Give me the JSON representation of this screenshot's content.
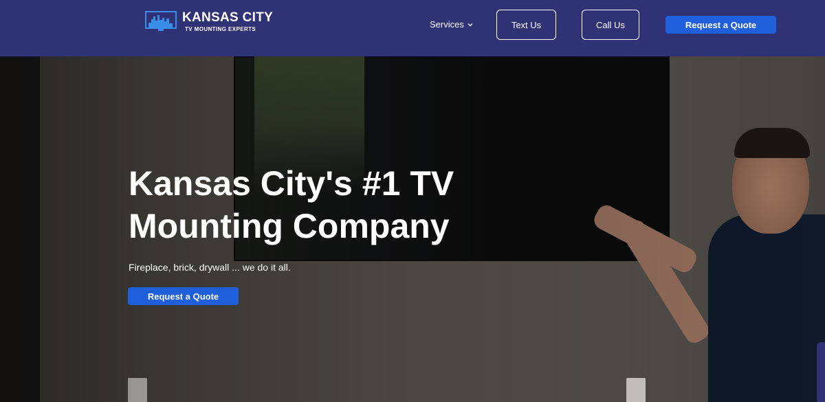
{
  "header": {
    "logo_title": "KANSAS CITY",
    "logo_subtitle": "TV MOUNTING EXPERTS",
    "nav_services": "Services",
    "text_us": "Text Us",
    "call_us": "Call Us",
    "request_quote": "Request a Quote"
  },
  "hero": {
    "title": "Kansas City's #1 TV Mounting Company",
    "subtitle": "Fireplace, brick, drywall ... we do it all.",
    "cta": "Request a Quote"
  },
  "icons": {
    "logo": "tv-skyline-icon",
    "services_dropdown": "chevron-down-icon"
  },
  "colors": {
    "header_bg": "#2f3275",
    "accent_button": "#1f5fd9",
    "text_light": "#ffffff"
  }
}
